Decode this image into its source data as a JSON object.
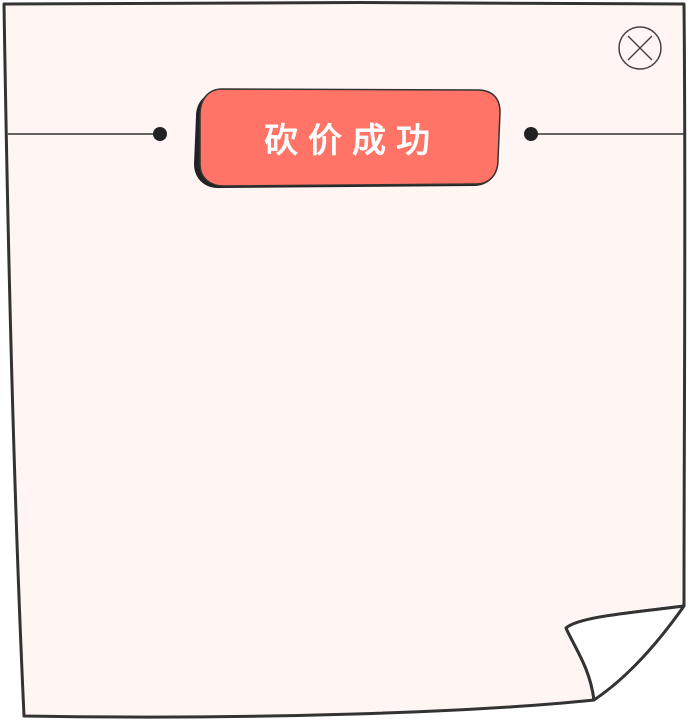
{
  "dialog": {
    "title": "砍价成功",
    "colors": {
      "paper": "#fff6f4",
      "outline": "#333333",
      "badge_fill": "#ff7466",
      "badge_shadow": "#222222",
      "title_text": "#ffffff"
    },
    "icons": {
      "close": "close-icon"
    }
  }
}
